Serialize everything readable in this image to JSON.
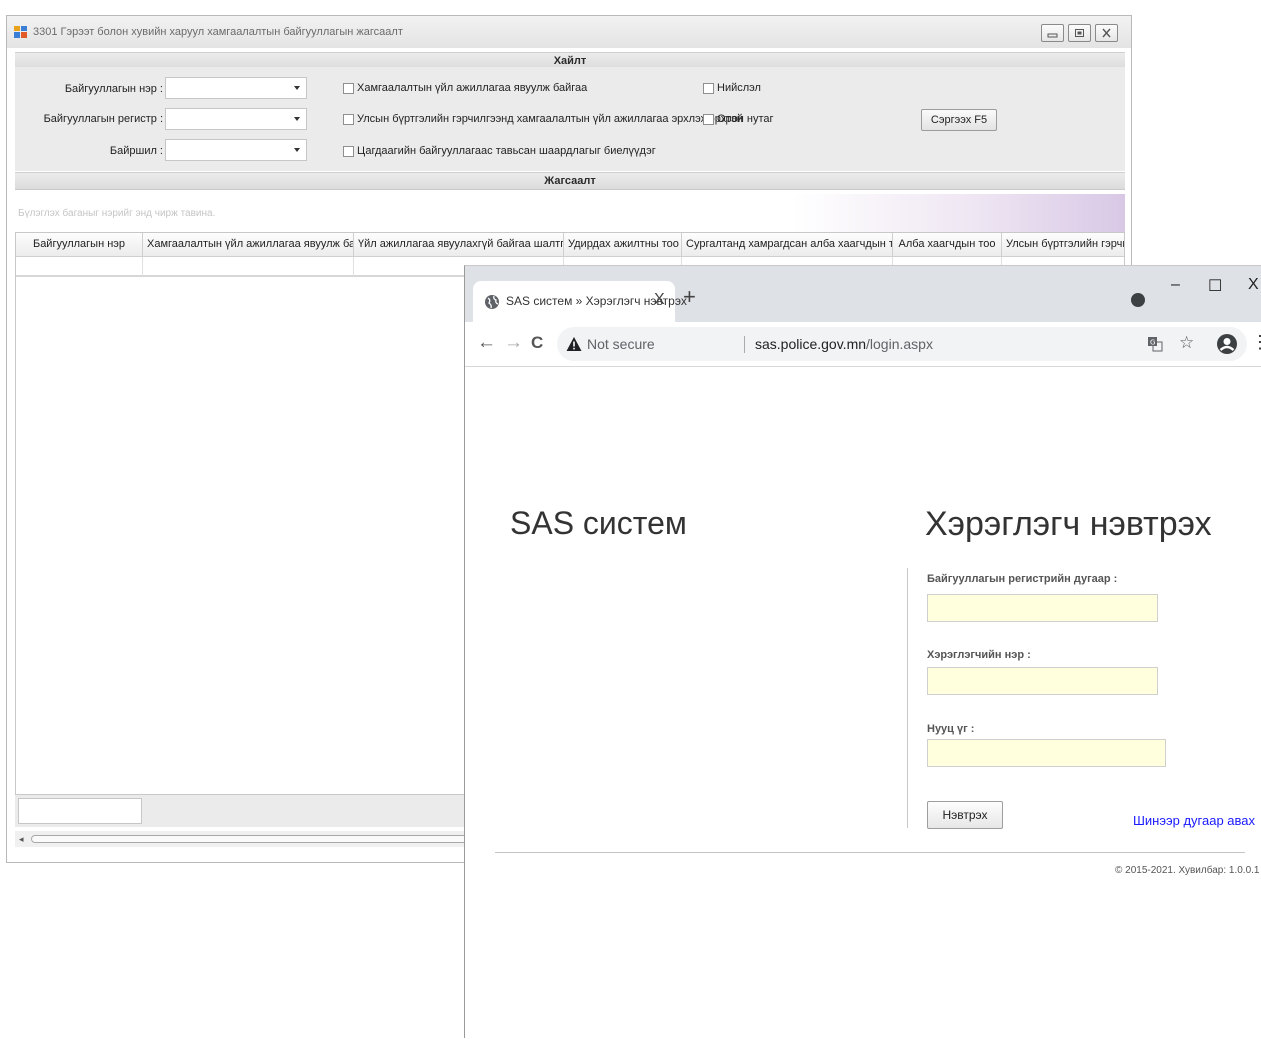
{
  "winforms": {
    "title": "3301 Гэрээт болон хувийн харуул хамгаалалтын байгууллагын жагсаалт",
    "search_header": "Хайлт",
    "labels": {
      "org_name": "Байгууллагын нэр :",
      "org_register": "Байгууллагын регистр :",
      "location": "Байршил :"
    },
    "checkboxes": {
      "active_protection": "Хамгаалалтын үйл ажиллагаа явуулж байгаа",
      "state_registered": "Улсын бүртгэлийн гэрчилгээнд хамгаалалтын үйл ажиллагаа эрхлэх эрхтэй",
      "police_requirements": "Цагдаагийн байгууллагаас тавьсан шаардлагыг биелүүдэг",
      "capital": "Нийслэл",
      "countryside": "Орон нутаг"
    },
    "refresh_button": "Сэргээх F5",
    "list_header": "Жагсаалт",
    "group_hint": "Бүлэглэх баганыг нэрийг энд чирж тавина.",
    "columns": [
      "Байгууллагын нэр",
      "Хамгаалалтын үйл ажиллагаа явуулж байгаа ...",
      "Үйл ажиллагаа явуулахгүй байгаа шалтгаан",
      "Удирдах ажилтны тоо",
      "Сургалтанд хамрагдсан алба хаагчдын тоо",
      "Алба хаагчдын тоо",
      "Улсын бүртгэлийн гэрчилгэ"
    ]
  },
  "chrome": {
    "tab_title": "SAS систем » Хэрэглэгч нэвтрэх",
    "tab_close": "X",
    "new_tab": "+",
    "controls": {
      "minimize": "–",
      "maximize": "☐",
      "close": "X"
    },
    "nav": {
      "back": "←",
      "forward": "→",
      "reload": "C"
    },
    "security_label": "Not secure",
    "url_host": "sas.police.gov.mn",
    "url_path": "/login.aspx",
    "menu": "⋮"
  },
  "login": {
    "brand": "SAS систем",
    "title": "Хэрэглэгч нэвтрэх",
    "register_label": "Байгууллагын регистрийн дугаар :",
    "username_label": "Хэрэглэгчийн нэр :",
    "password_label": "Нууц үг :",
    "login_button": "Нэвтрэх",
    "new_number_link": "Шинээр дугаар авах",
    "copyright": "© 2015-2021. Хувилбар: 1.0.0.1"
  }
}
